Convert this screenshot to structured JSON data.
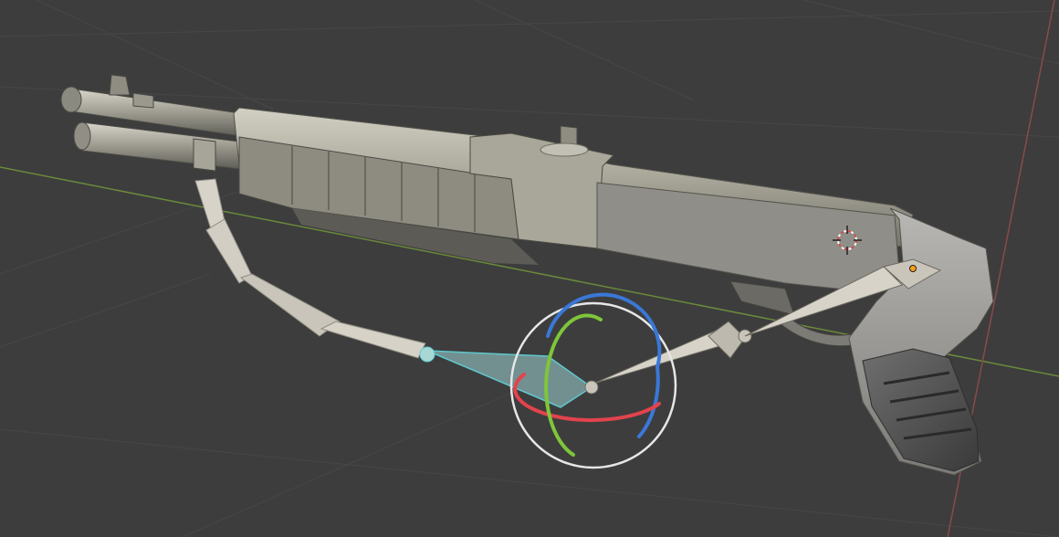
{
  "viewport": {
    "background": "#3d3d3d",
    "grid_color": "#474747",
    "x_axis_color": "#8a4a4a",
    "y_axis_color": "#6a8a3a"
  },
  "object": {
    "metal_color": "#b5b3a6",
    "metal_dark": "#7d7c73",
    "grip_color": "#4a4a4a"
  },
  "bones": {
    "color": "#d7d3c9",
    "selected_color": "#9fd6d6",
    "selected_outline": "#5fc8cf"
  },
  "gizmo": {
    "mode": "rotate",
    "ring_outer_color": "#e6e6e6",
    "x_color": "#e2434d",
    "y_color": "#7ec63a",
    "z_color": "#3a78d8"
  },
  "cursor_3d": {
    "icon": "3d-cursor-icon",
    "colors": [
      "#d94545",
      "#ffffff"
    ]
  },
  "origin_marker": {
    "icon": "origin-dot-icon",
    "color": "#ff9f1a"
  }
}
